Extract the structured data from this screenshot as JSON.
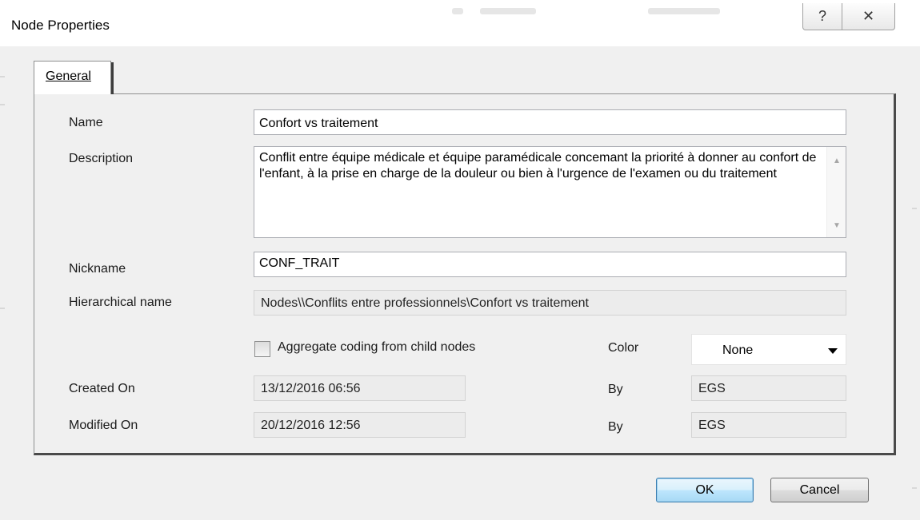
{
  "window": {
    "title": "Node Properties",
    "help_glyph": "?",
    "close_glyph": "✕"
  },
  "tabs": [
    {
      "label": "General",
      "selected": true
    }
  ],
  "form": {
    "name": {
      "label": "Name",
      "value": "Confort vs traitement"
    },
    "description": {
      "label": "Description",
      "value": "Conflit entre équipe médicale et équipe paramédicale concemant la priorité à donner au confort de l'enfant, à la prise en charge de la douleur ou bien à l'urgence de l'examen ou du traitement"
    },
    "nickname": {
      "label": "Nickname",
      "value": "CONF_TRAIT"
    },
    "hierarchical_name": {
      "label": "Hierarchical name",
      "value": "Nodes\\\\Conflits entre professionnels\\Confort vs traitement"
    },
    "aggregate": {
      "label": "Aggregate coding from child nodes",
      "checked": false
    },
    "color": {
      "label": "Color",
      "value": "None"
    },
    "created": {
      "label": "Created On",
      "value": "13/12/2016 06:56",
      "by_label": "By",
      "by_value": "EGS"
    },
    "modified": {
      "label": "Modified On",
      "value": "20/12/2016 12:56",
      "by_label": "By",
      "by_value": "EGS"
    }
  },
  "buttons": {
    "ok": "OK",
    "cancel": "Cancel"
  },
  "colors": {
    "dialog_bg": "#f0f0f0",
    "ok_border": "#3c7fb1"
  }
}
